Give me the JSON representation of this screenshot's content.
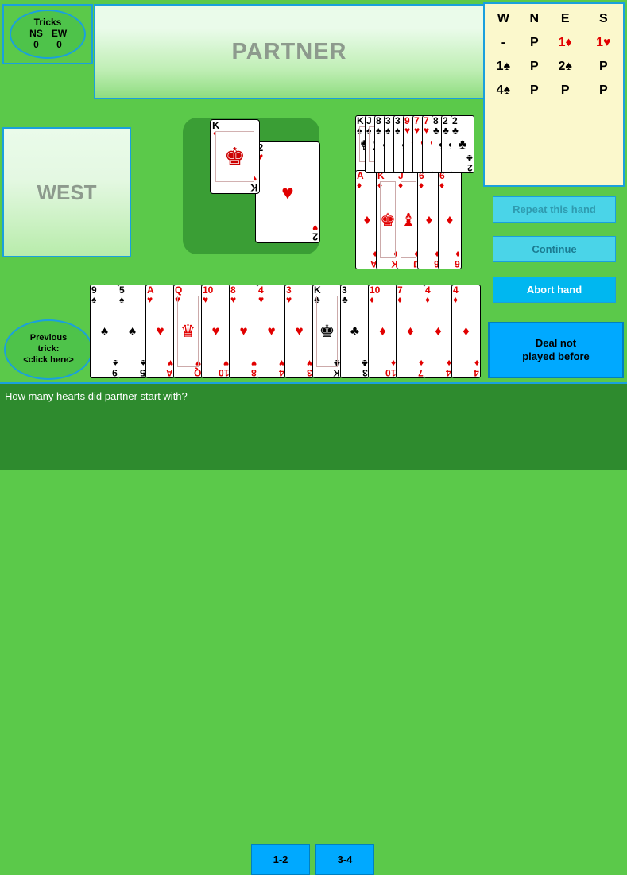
{
  "tricks": {
    "title": "Tricks",
    "label_ns": "NS",
    "label_ew": "EW",
    "value_ns": "0",
    "value_ew": "0"
  },
  "partner_label": "PARTNER",
  "west_label": "WEST",
  "bidding": {
    "headers": [
      "W",
      "N",
      "E",
      "S"
    ],
    "rows": [
      [
        {
          "t": "-",
          "c": "black"
        },
        {
          "t": "P",
          "c": "black"
        },
        {
          "t": "1♦",
          "c": "red"
        },
        {
          "t": "1♥",
          "c": "red"
        }
      ],
      [
        {
          "t": "1♠",
          "c": "black"
        },
        {
          "t": "P",
          "c": "black"
        },
        {
          "t": "2♠",
          "c": "black"
        },
        {
          "t": "P",
          "c": "black"
        }
      ],
      [
        {
          "t": "4♠",
          "c": "black"
        },
        {
          "t": "P",
          "c": "black"
        },
        {
          "t": "P",
          "c": "black"
        },
        {
          "t": "P",
          "c": "black"
        }
      ]
    ]
  },
  "trick_cards": [
    {
      "rank": "K",
      "suit": "♥",
      "color": "red",
      "name": "trick-card-king-hearts"
    },
    {
      "rank": "2",
      "suit": "♥",
      "color": "red",
      "name": "trick-card-two-hearts"
    }
  ],
  "north_hand": {
    "row1": [
      {
        "rank": "K",
        "suit": "♠",
        "color": "black"
      },
      {
        "rank": "J",
        "suit": "♠",
        "color": "black"
      },
      {
        "rank": "8",
        "suit": "♠",
        "color": "black"
      },
      {
        "rank": "3",
        "suit": "♠",
        "color": "black"
      },
      {
        "rank": "3",
        "suit": "♠",
        "color": "black"
      },
      {
        "rank": "9",
        "suit": "♥",
        "color": "red"
      },
      {
        "rank": "7",
        "suit": "♥",
        "color": "red"
      },
      {
        "rank": "7",
        "suit": "♥",
        "color": "red"
      },
      {
        "rank": "8",
        "suit": "♣",
        "color": "black"
      },
      {
        "rank": "2",
        "suit": "♣",
        "color": "black"
      },
      {
        "rank": "2",
        "suit": "♣",
        "color": "black"
      }
    ],
    "row2": [
      {
        "rank": "A",
        "suit": "♦",
        "color": "red"
      },
      {
        "rank": "K",
        "suit": "♦",
        "color": "red"
      },
      {
        "rank": "J",
        "suit": "♦",
        "color": "red"
      },
      {
        "rank": "6",
        "suit": "♦",
        "color": "red"
      },
      {
        "rank": "6",
        "suit": "♦",
        "color": "red"
      }
    ]
  },
  "south_hand": [
    {
      "rank": "9",
      "suit": "♠",
      "color": "black"
    },
    {
      "rank": "5",
      "suit": "♠",
      "color": "black"
    },
    {
      "rank": "A",
      "suit": "♥",
      "color": "red"
    },
    {
      "rank": "Q",
      "suit": "♥",
      "color": "red"
    },
    {
      "rank": "10",
      "suit": "♥",
      "color": "red"
    },
    {
      "rank": "8",
      "suit": "♥",
      "color": "red"
    },
    {
      "rank": "4",
      "suit": "♥",
      "color": "red"
    },
    {
      "rank": "3",
      "suit": "♥",
      "color": "red"
    },
    {
      "rank": "K",
      "suit": "♣",
      "color": "black"
    },
    {
      "rank": "3",
      "suit": "♣",
      "color": "black"
    },
    {
      "rank": "10",
      "suit": "♦",
      "color": "red"
    },
    {
      "rank": "7",
      "suit": "♦",
      "color": "red"
    },
    {
      "rank": "4",
      "suit": "♦",
      "color": "red"
    },
    {
      "rank": "4",
      "suit": "♦",
      "color": "red"
    }
  ],
  "buttons": {
    "repeat": "Repeat this hand",
    "continue": "Continue",
    "abort": "Abort hand",
    "deal_not_played_line1": "Deal not",
    "deal_not_played_line2": "played before"
  },
  "previous_trick": {
    "line1": "Previous",
    "line2": "trick:",
    "line3": "<click here>"
  },
  "question": "How many hearts did partner start with?",
  "answers": [
    "1-2",
    "3-4"
  ],
  "colors": {
    "table_green": "#5bc94a",
    "panel_blue_border": "#1aa0dd",
    "button_cyan": "#4ad4e8",
    "button_blue": "#00a9ff",
    "bidding_bg": "#fbf8cc",
    "red_suit": "#e10000"
  }
}
